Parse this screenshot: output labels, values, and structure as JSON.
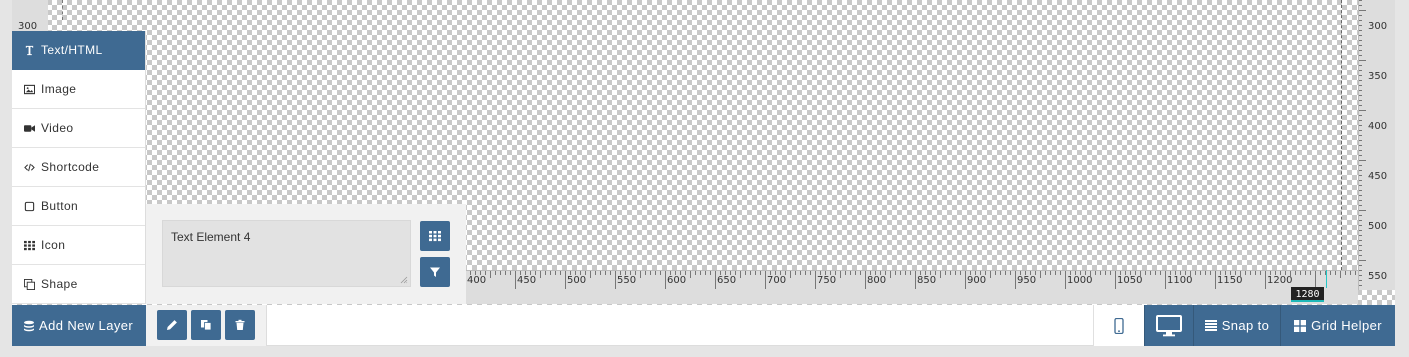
{
  "rulers": {
    "left_labels": [
      "300"
    ],
    "right_labels": [
      "300",
      "350",
      "400",
      "450",
      "500",
      "550"
    ],
    "bottom_labels": [
      "400",
      "450",
      "500",
      "550",
      "600",
      "650",
      "700",
      "750",
      "800",
      "850",
      "900",
      "950",
      "1000",
      "1050",
      "1100",
      "1150",
      "1200"
    ],
    "cursor_position": "1280"
  },
  "layer_menu": {
    "items": [
      {
        "label": "Text/HTML",
        "icon": "text-cursor-icon",
        "active": true
      },
      {
        "label": "Image",
        "icon": "image-icon",
        "active": false
      },
      {
        "label": "Video",
        "icon": "video-camera-icon",
        "active": false
      },
      {
        "label": "Shortcode",
        "icon": "code-icon",
        "active": false
      },
      {
        "label": "Button",
        "icon": "square-outline-icon",
        "active": false
      },
      {
        "label": "Icon",
        "icon": "grid-icon",
        "active": false
      },
      {
        "label": "Shape",
        "icon": "clone-icon",
        "active": false
      }
    ]
  },
  "layer_panel": {
    "text_value": "Text Element 4"
  },
  "bottom_bar": {
    "add_layer_label": "Add New Layer",
    "snap_label": "Snap to",
    "grid_helper_label": "Grid Helper"
  },
  "colors": {
    "accent": "#3f6a92",
    "cursor_line": "#24c7c7"
  }
}
